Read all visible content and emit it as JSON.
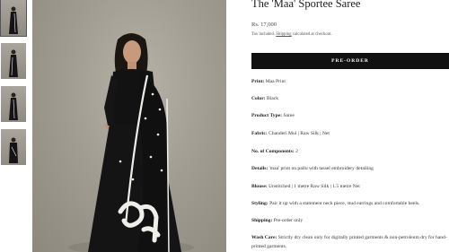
{
  "product": {
    "title": "The 'Maa' Sportee Saree",
    "price": "Rs. 17,000",
    "tax_note_prefix": "Tax included.",
    "tax_note_link": "Shipping",
    "tax_note_suffix": "calculated at checkout.",
    "preorder_label": "PRE-ORDER"
  },
  "specs": [
    {
      "label": "Print:",
      "value": "Maa Print"
    },
    {
      "label": "Color:",
      "value": "Black"
    },
    {
      "label": "Product Type:",
      "value": "Saree"
    },
    {
      "label": "Fabric:",
      "value": "Chanderi Mul | Raw Silk | Net"
    },
    {
      "label": "No. of Components:",
      "value": "2"
    },
    {
      "label": "Details:",
      "value": "'maa' print on pallu with tassel embroidery detailing"
    },
    {
      "label": "Blouse:",
      "value": "Unstitched | 1 metre Raw Silk | 1.5 metre Net"
    },
    {
      "label": "Styling:",
      "value": "Pair it up with a statement neck piece, stud earrings and comfortable heels."
    },
    {
      "label": "Shipping:",
      "value": "Pre-order only"
    },
    {
      "label": "Wash Care:",
      "value": "Strictly dry clean only for digitally printed garments & non-petroleum dry for hand-printed garments."
    }
  ],
  "gallery": {
    "thumbnail_count": 4,
    "active_index": 0
  },
  "colors": {
    "button_bg": "#111111",
    "saree": "#141414",
    "backdrop": "#a29d93"
  }
}
